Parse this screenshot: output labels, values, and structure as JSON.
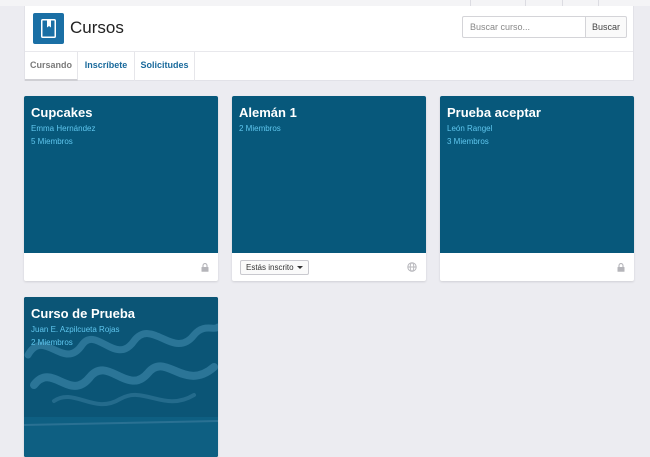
{
  "header": {
    "title": "Cursos",
    "search_placeholder": "Buscar curso...",
    "search_button": "Buscar"
  },
  "tabs": [
    {
      "label": "Cursando",
      "active": true
    },
    {
      "label": "Inscríbete",
      "active": false
    },
    {
      "label": "Solicitudes",
      "active": false
    }
  ],
  "courses": [
    {
      "title": "Cupcakes",
      "teacher": "Emma Hernández",
      "members": "5 Miembros",
      "footer_icon": "lock-icon"
    },
    {
      "title": "Alemán 1",
      "members": "2 Miembros",
      "enrolled_label": "Estás inscrito",
      "footer_icon": "globe-icon"
    },
    {
      "title": "Prueba aceptar",
      "teacher": "León Rangel",
      "members": "3 Miembros",
      "footer_icon": "lock-icon"
    },
    {
      "title": "Curso de Prueba",
      "teacher": "Juan E. Azpilcueta Rojas",
      "members": "2 Miembros"
    }
  ],
  "colors": {
    "accent": "#1a6fa5",
    "card_banner": "#07587b",
    "meta_text": "#5fc6ee",
    "link": "#1a6a9c"
  }
}
